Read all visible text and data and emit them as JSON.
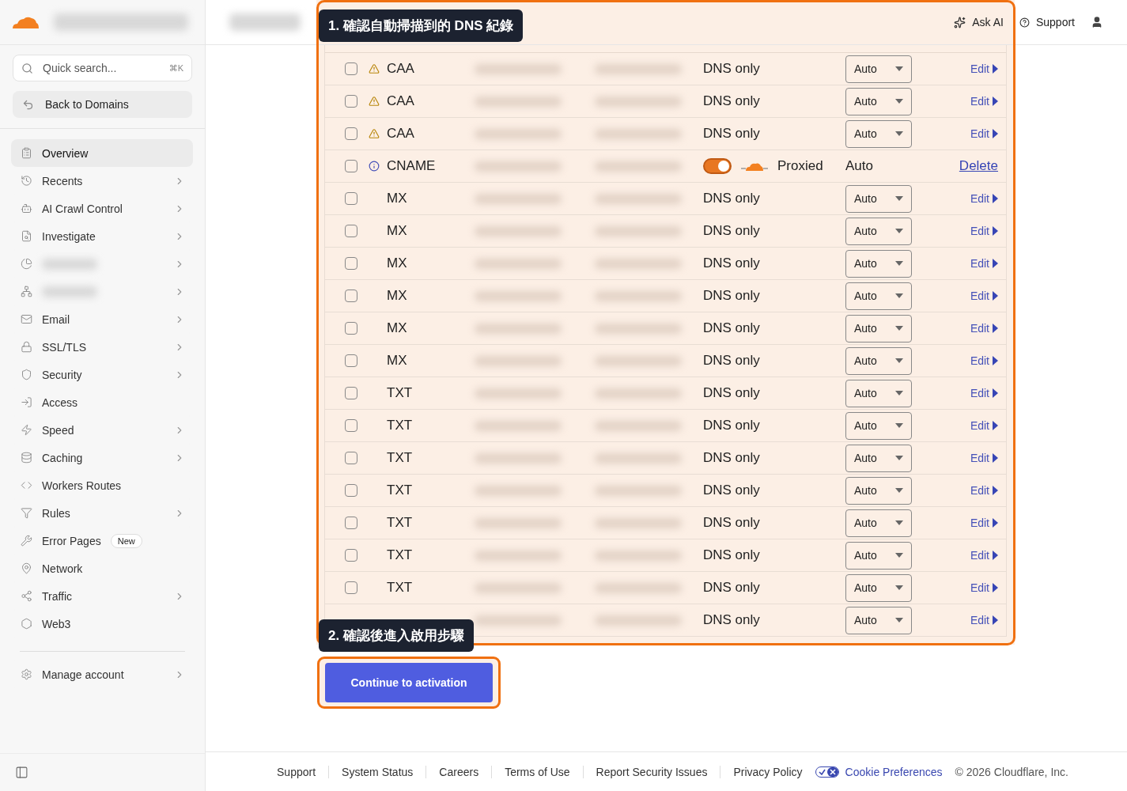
{
  "sidebar": {
    "search": {
      "placeholder": "Quick search...",
      "shortcut": "⌘K"
    },
    "back_button": "Back to Domains",
    "items": [
      {
        "kind": "plain",
        "label": "Overview",
        "expandable": false,
        "selected": true
      },
      {
        "kind": "plain",
        "label": "Recents",
        "expandable": true,
        "selected": false
      },
      {
        "kind": "plain",
        "label": "AI Crawl Control",
        "expandable": true,
        "selected": false
      },
      {
        "kind": "plain",
        "label": "Investigate",
        "expandable": true,
        "selected": false
      },
      {
        "kind": "redacted",
        "expandable": true,
        "selected": false
      },
      {
        "kind": "redacted",
        "expandable": true,
        "selected": false
      },
      {
        "kind": "plain",
        "label": "Email",
        "expandable": true,
        "selected": false
      },
      {
        "kind": "plain",
        "label": "SSL/TLS",
        "expandable": true,
        "selected": false
      },
      {
        "kind": "plain",
        "label": "Security",
        "expandable": true,
        "selected": false
      },
      {
        "kind": "plain",
        "label": "Access",
        "expandable": false,
        "selected": false
      },
      {
        "kind": "plain",
        "label": "Speed",
        "expandable": true,
        "selected": false
      },
      {
        "kind": "plain",
        "label": "Caching",
        "expandable": true,
        "selected": false
      },
      {
        "kind": "plain",
        "label": "Workers Routes",
        "expandable": false,
        "selected": false
      },
      {
        "kind": "plain",
        "label": "Rules",
        "expandable": true,
        "selected": false
      },
      {
        "kind": "plain",
        "label": "Error Pages",
        "badge": "New",
        "expandable": false,
        "selected": false
      },
      {
        "kind": "plain",
        "label": "Network",
        "expandable": false,
        "selected": false
      },
      {
        "kind": "plain",
        "label": "Traffic",
        "expandable": true,
        "selected": false
      },
      {
        "kind": "plain",
        "label": "Web3",
        "expandable": false,
        "selected": false
      }
    ],
    "account_item": {
      "label": "Manage account",
      "expandable": true
    }
  },
  "header": {
    "ask_ai": "Ask AI",
    "support": "Support"
  },
  "callouts": [
    "1. 確認自動掃描到的 DNS 紀錄",
    "2. 確認後進入啟用步驟"
  ],
  "dns_rows": [
    {
      "kind": "dns_only",
      "checked": false,
      "warning": true,
      "info": false,
      "type": "CAA",
      "proxy": "DNS only",
      "ttl": "Auto",
      "action": "Edit"
    },
    {
      "kind": "dns_only",
      "checked": false,
      "warning": true,
      "info": false,
      "type": "CAA",
      "proxy": "DNS only",
      "ttl": "Auto",
      "action": "Edit"
    },
    {
      "kind": "dns_only",
      "checked": false,
      "warning": true,
      "info": false,
      "type": "CAA",
      "proxy": "DNS only",
      "ttl": "Auto",
      "action": "Edit"
    },
    {
      "kind": "proxied",
      "checked": false,
      "warning": false,
      "info": true,
      "type": "CNAME",
      "proxy": "Proxied",
      "proxy_on": true,
      "ttl": "Auto",
      "action": "Delete"
    },
    {
      "kind": "dns_only",
      "checked": false,
      "type": "MX",
      "proxy": "DNS only",
      "ttl": "Auto",
      "action": "Edit"
    },
    {
      "kind": "dns_only",
      "checked": false,
      "type": "MX",
      "proxy": "DNS only",
      "ttl": "Auto",
      "action": "Edit"
    },
    {
      "kind": "dns_only",
      "checked": false,
      "type": "MX",
      "proxy": "DNS only",
      "ttl": "Auto",
      "action": "Edit"
    },
    {
      "kind": "dns_only",
      "checked": false,
      "type": "MX",
      "proxy": "DNS only",
      "ttl": "Auto",
      "action": "Edit"
    },
    {
      "kind": "dns_only",
      "checked": false,
      "type": "MX",
      "proxy": "DNS only",
      "ttl": "Auto",
      "action": "Edit"
    },
    {
      "kind": "dns_only",
      "checked": false,
      "type": "MX",
      "proxy": "DNS only",
      "ttl": "Auto",
      "action": "Edit"
    },
    {
      "kind": "dns_only",
      "checked": false,
      "type": "TXT",
      "proxy": "DNS only",
      "ttl": "Auto",
      "action": "Edit"
    },
    {
      "kind": "dns_only",
      "checked": false,
      "type": "TXT",
      "proxy": "DNS only",
      "ttl": "Auto",
      "action": "Edit"
    },
    {
      "kind": "dns_only",
      "checked": false,
      "type": "TXT",
      "proxy": "DNS only",
      "ttl": "Auto",
      "action": "Edit"
    },
    {
      "kind": "dns_only",
      "checked": false,
      "type": "TXT",
      "proxy": "DNS only",
      "ttl": "Auto",
      "action": "Edit"
    },
    {
      "kind": "dns_only",
      "checked": false,
      "type": "TXT",
      "proxy": "DNS only",
      "ttl": "Auto",
      "action": "Edit"
    },
    {
      "kind": "dns_only",
      "checked": false,
      "type": "TXT",
      "proxy": "DNS only",
      "ttl": "Auto",
      "action": "Edit"
    },
    {
      "kind": "dns_only",
      "checked": false,
      "type": "TXT",
      "proxy": "DNS only",
      "ttl": "Auto",
      "action": "Edit"
    },
    {
      "kind": "dns_only",
      "proxy": "DNS only",
      "ttl": "Auto",
      "action": "Edit"
    }
  ],
  "continue_button": "Continue to activation",
  "footer": {
    "links": [
      "Support",
      "System Status",
      "Careers",
      "Terms of Use",
      "Report Security Issues",
      "Privacy Policy"
    ],
    "cookie_preferences": "Cookie Preferences",
    "copyright": "© 2026 Cloudflare, Inc."
  }
}
